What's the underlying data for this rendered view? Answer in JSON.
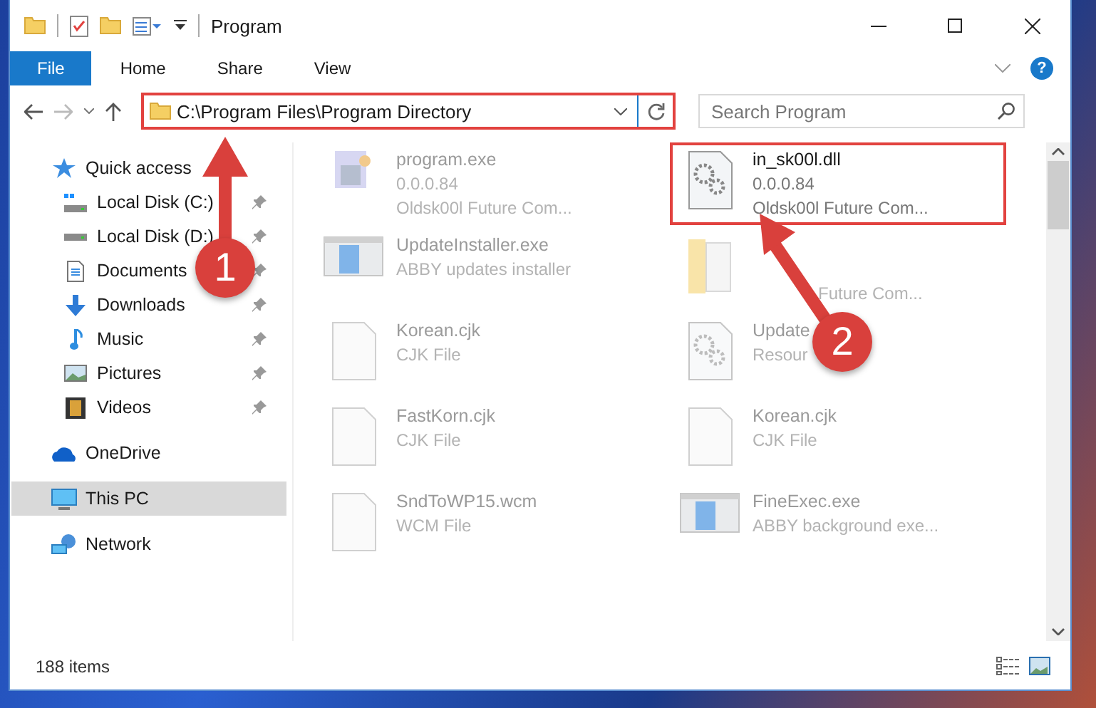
{
  "window": {
    "title": "Program"
  },
  "ribbon_tabs": [
    {
      "label": "File",
      "kind": "file"
    },
    {
      "label": "Home",
      "kind": "tab"
    },
    {
      "label": "Share",
      "kind": "tab"
    },
    {
      "label": "View",
      "kind": "tab"
    }
  ],
  "help_button": {
    "label": "?"
  },
  "address": {
    "path": "C:\\Program Files\\Program Directory",
    "highlighted": true
  },
  "search": {
    "placeholder": "Search Program"
  },
  "nav": [
    {
      "label": "Quick access",
      "kind": "star",
      "selected": false,
      "children": [
        {
          "label": "Local Disk (C:)",
          "kind": "sysdrive",
          "selected": false,
          "pinned": true
        },
        {
          "label": "Local Disk (D:)",
          "kind": "drive",
          "selected": false,
          "pinned": true
        },
        {
          "label": "Documents",
          "kind": "docs",
          "selected": false,
          "pinned": true
        },
        {
          "label": "Downloads",
          "kind": "down",
          "selected": false,
          "pinned": true
        },
        {
          "label": "Music",
          "kind": "music",
          "selected": false,
          "pinned": true
        },
        {
          "label": "Pictures",
          "kind": "pics",
          "selected": false,
          "pinned": true
        },
        {
          "label": "Videos",
          "kind": "video",
          "selected": false,
          "pinned": true
        }
      ]
    },
    {
      "label": "OneDrive",
      "kind": "cloud",
      "selected": false
    },
    {
      "label": "This PC",
      "kind": "pc",
      "selected": true
    },
    {
      "label": "Network",
      "kind": "network",
      "selected": false
    }
  ],
  "files": [
    {
      "name": "program.exe",
      "details": [
        "0.0.0.84",
        "Oldsk00l Future Com..."
      ],
      "kind": "app",
      "blurred": true
    },
    {
      "name": "in_sk00l.dll",
      "details": [
        "0.0.0.84",
        "Oldsk00l Future Com..."
      ],
      "kind": "dll",
      "blurred": false,
      "highlighted": true
    },
    {
      "name": "UpdateInstaller.exe",
      "details": [
        "ABBY updates installer"
      ],
      "kind": "window",
      "blurred": true
    },
    {
      "details": [
        "Future Com..."
      ],
      "kind": "folder",
      "blurred": true
    },
    {
      "name": "Korean.cjk",
      "details": [
        "CJK File"
      ],
      "kind": "doc",
      "blurred": true
    },
    {
      "name": "Update",
      "details": [
        "Resour"
      ],
      "kind": "dll",
      "blurred": true
    },
    {
      "name": "FastKorn.cjk",
      "details": [
        "CJK File"
      ],
      "kind": "doc",
      "blurred": true
    },
    {
      "name": "Korean.cjk",
      "details": [
        "CJK File"
      ],
      "kind": "doc",
      "blurred": true
    },
    {
      "name": "SndToWP15.wcm",
      "details": [
        "WCM File"
      ],
      "kind": "doc",
      "blurred": true
    },
    {
      "name": "FineExec.exe",
      "details": [
        "ABBY background exe..."
      ],
      "kind": "window",
      "blurred": true
    }
  ],
  "status_bar": {
    "count": "188 items"
  },
  "callouts": [
    {
      "number": "1"
    },
    {
      "number": "2"
    }
  ]
}
